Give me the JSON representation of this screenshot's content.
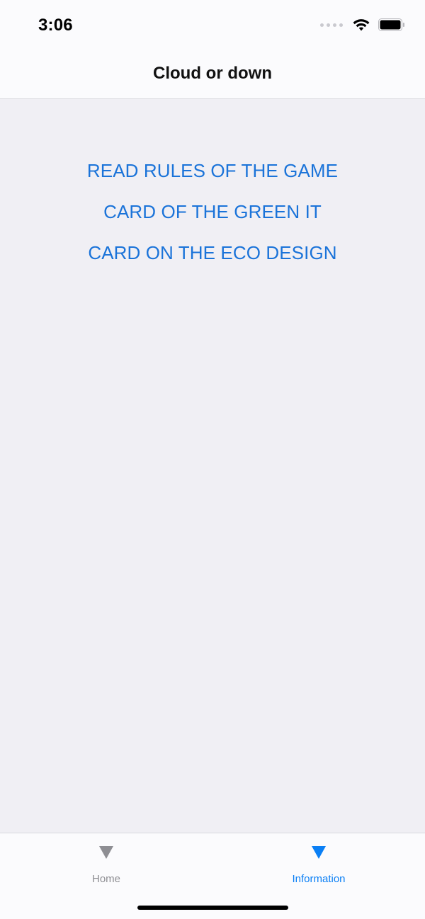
{
  "status_bar": {
    "time": "3:06",
    "icons": [
      "signal-dots-icon",
      "wifi-icon",
      "battery-icon"
    ]
  },
  "nav": {
    "title": "Cloud or down"
  },
  "links": [
    {
      "label": "READ RULES OF THE GAME"
    },
    {
      "label": "CARD OF THE GREEN IT"
    },
    {
      "label": "CARD ON THE ECO DESIGN"
    }
  ],
  "tabbar": {
    "items": [
      {
        "label": "Home",
        "icon": "triangle-down-icon",
        "active": false
      },
      {
        "label": "Information",
        "icon": "triangle-down-icon",
        "active": true
      }
    ]
  },
  "colors": {
    "link": "#1a73d9",
    "tab_active": "#0a7ff5",
    "tab_inactive": "#8e8e93",
    "background": "#f0eff4",
    "bar_background": "#fbfbfd"
  }
}
